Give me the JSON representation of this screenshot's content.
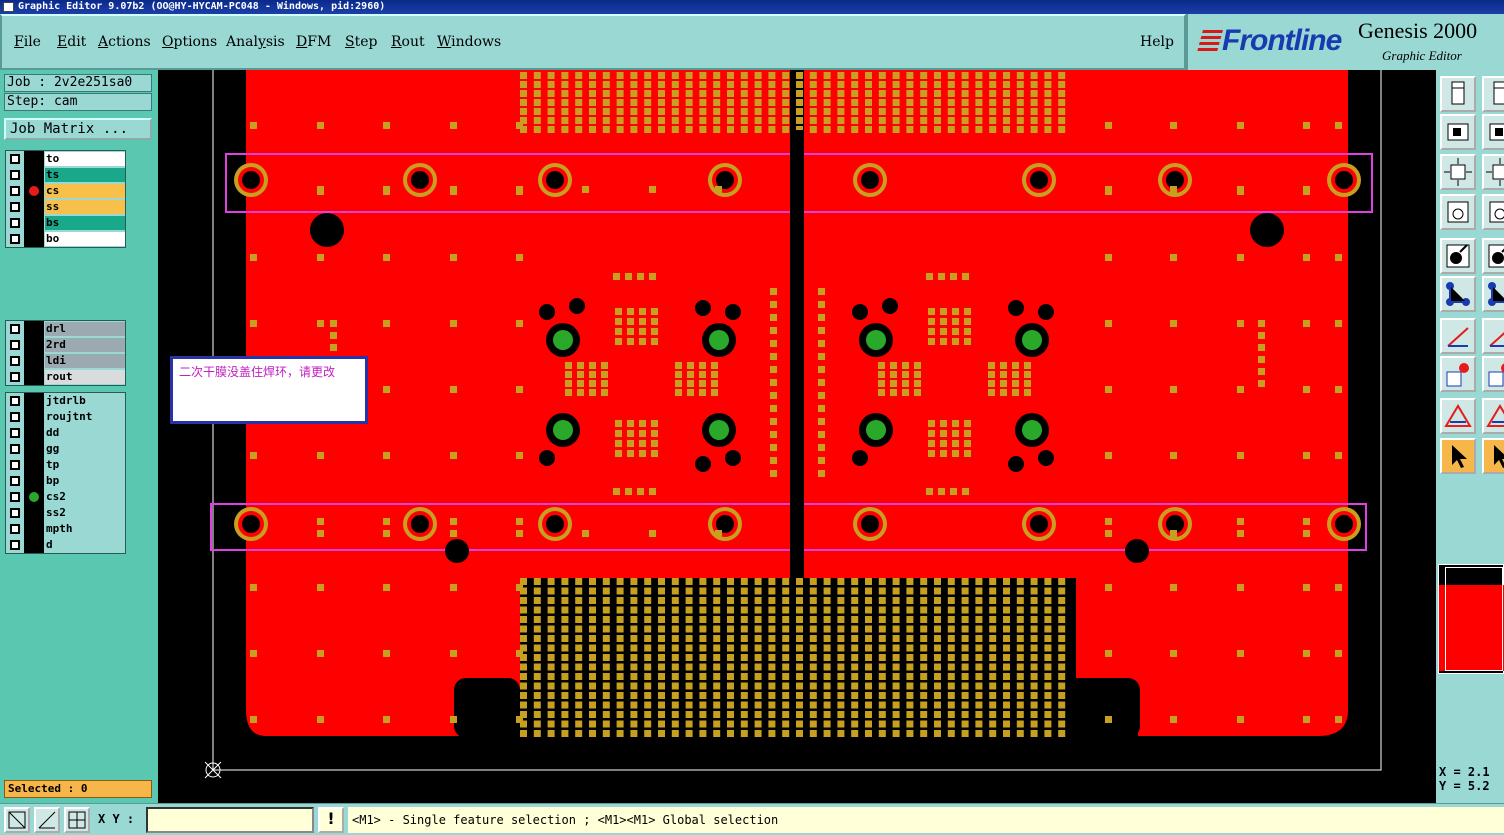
{
  "title_bar": "Graphic Editor 9.07b2 (OO@HY-HYCAM-PC048 - Windows, pid:2960)",
  "menu": [
    {
      "label": "File",
      "key": "F"
    },
    {
      "label": "Edit",
      "key": "E"
    },
    {
      "label": "Actions",
      "key": "A"
    },
    {
      "label": "Options",
      "key": "O"
    },
    {
      "label": "Analysis",
      "key": "y"
    },
    {
      "label": "DFM",
      "key": "D"
    },
    {
      "label": "Step",
      "key": "S"
    },
    {
      "label": "Rout",
      "key": "R"
    },
    {
      "label": "Windows",
      "key": "W"
    }
  ],
  "help_label": "Help",
  "brand": {
    "logo": "Frontline",
    "title": "Genesis 2000",
    "subtitle": "Graphic Editor"
  },
  "job": "Job : 2v2e251sa0",
  "step": "Step: cam",
  "job_matrix_label": "Job Matrix ...",
  "layer_groups": [
    [
      {
        "name": "to",
        "color": "#ffffff"
      },
      {
        "name": "ts",
        "color": "#1aa88a"
      },
      {
        "name": "cs",
        "color": "#f7c04a",
        "active_color": "#e81a1a"
      },
      {
        "name": "ss",
        "color": "#f7c04a"
      },
      {
        "name": "bs",
        "color": "#1aa88a"
      },
      {
        "name": "bo",
        "color": "#ffffff"
      }
    ],
    [
      {
        "name": "drl",
        "color": "#9aaab0"
      },
      {
        "name": "2rd",
        "color": "#9aaab0"
      },
      {
        "name": "ldi",
        "color": "#9aaab0"
      },
      {
        "name": "rout",
        "color": "#d8dcdc"
      }
    ],
    [
      {
        "name": "jtdrlb",
        "color": "#9ad8d4"
      },
      {
        "name": "roujtnt",
        "color": "#9ad8d4"
      },
      {
        "name": "dd",
        "color": "#9ad8d4"
      },
      {
        "name": "gg",
        "color": "#9ad8d4"
      },
      {
        "name": "tp",
        "color": "#9ad8d4"
      },
      {
        "name": "bp",
        "color": "#9ad8d4"
      },
      {
        "name": "cs2",
        "color": "#9ad8d4",
        "active_color": "#2aa82a"
      },
      {
        "name": "ss2",
        "color": "#9ad8d4"
      },
      {
        "name": "mpth",
        "color": "#9ad8d4"
      },
      {
        "name": "d",
        "color": "#9ad8d4"
      }
    ]
  ],
  "selected": "Selected : 0",
  "note": "二次干膜没盖住焊环，请更改",
  "coords": {
    "x": "X = 2.1",
    "y": "Y = 5.2"
  },
  "xy_label": "X Y :",
  "xy_value": "",
  "hint": "<M1> - Single feature selection ; <M1><M1> Global selection",
  "colors": {
    "board": "#ff0000",
    "pad": "#c8a020",
    "highlight": "#e040e0",
    "inner_pad": "#2aa82a"
  }
}
